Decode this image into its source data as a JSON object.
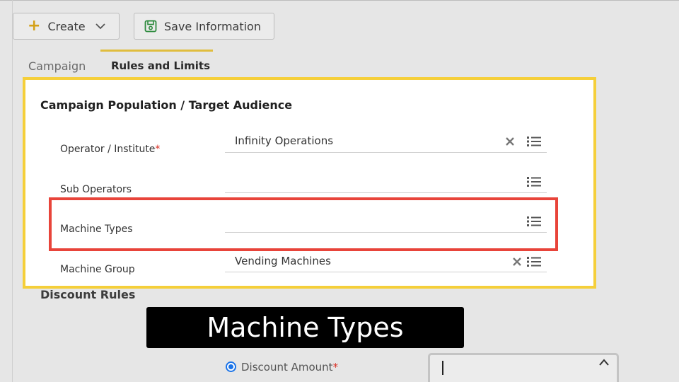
{
  "toolbar": {
    "create_label": "Create",
    "save_label": "Save Information"
  },
  "tabs": [
    {
      "label": "Campaign"
    },
    {
      "label": "Rules and Limits"
    }
  ],
  "population": {
    "title": "Campaign Population / Target Audience",
    "fields": [
      {
        "label": "Operator / Institute",
        "required": "*",
        "value": "Infinity Operations"
      },
      {
        "label": "Sub Operators",
        "value": ""
      },
      {
        "label": "Machine Types",
        "value": ""
      },
      {
        "label": "Machine Group",
        "value": "Vending Machines"
      }
    ]
  },
  "discount": {
    "title": "Discount Rules",
    "option_label": "Discount Amount",
    "required": "*"
  },
  "caption": "Machine Types",
  "colors": {
    "highlight_yellow": "#f5cf3a",
    "highlight_red": "#e8443a",
    "radio_blue": "#1a73e8"
  }
}
